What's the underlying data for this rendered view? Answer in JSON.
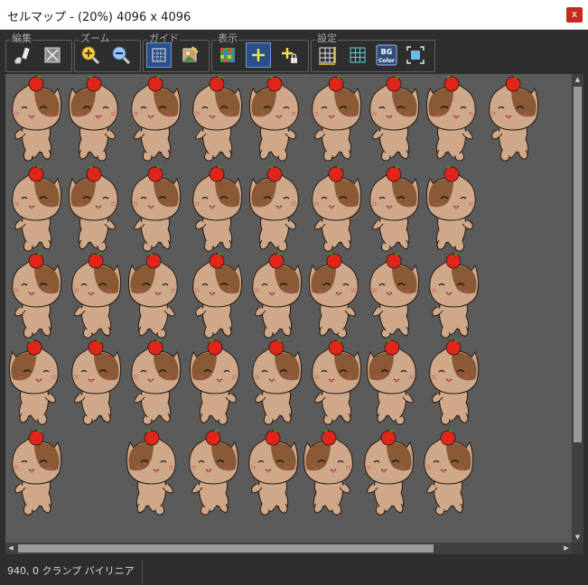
{
  "window": {
    "title": "セルマップ - (20%) 4096 x 4096",
    "close_label": "x"
  },
  "toolbar": {
    "groups": [
      {
        "label": "編集",
        "buttons": [
          "brush-eraser-icon",
          "select-all-icon"
        ]
      },
      {
        "label": "ズーム",
        "buttons": [
          "zoom-in-icon",
          "zoom-out-icon"
        ]
      },
      {
        "label": "ガイド",
        "buttons": [
          "grid-guide-icon",
          "image-guide-icon"
        ]
      },
      {
        "label": "表示",
        "buttons": [
          "checkerboard-icon",
          "crosshair-icon",
          "crosshair-lock-icon"
        ]
      },
      {
        "label": "設定",
        "buttons": [
          "grid-size-icon",
          "grid-color-icon",
          "bg-color-icon",
          "fit-icon"
        ]
      }
    ],
    "bg_button_text": "BG",
    "color_button_text": "Color",
    "active_buttons": [
      "grid-guide-icon",
      "crosshair-icon"
    ]
  },
  "canvas": {
    "zoom": "20%",
    "size": "4096 x 4096",
    "background": "#5b5b5b",
    "row_counts": [
      9,
      8,
      8,
      8,
      7
    ]
  },
  "colors": {
    "body": "#cfa88a",
    "body_dark": "#8a5a36",
    "apple": "#e0251b",
    "outline": "#2a1a10"
  },
  "status": {
    "text": "940, 0  クランプ  バイリニア"
  }
}
